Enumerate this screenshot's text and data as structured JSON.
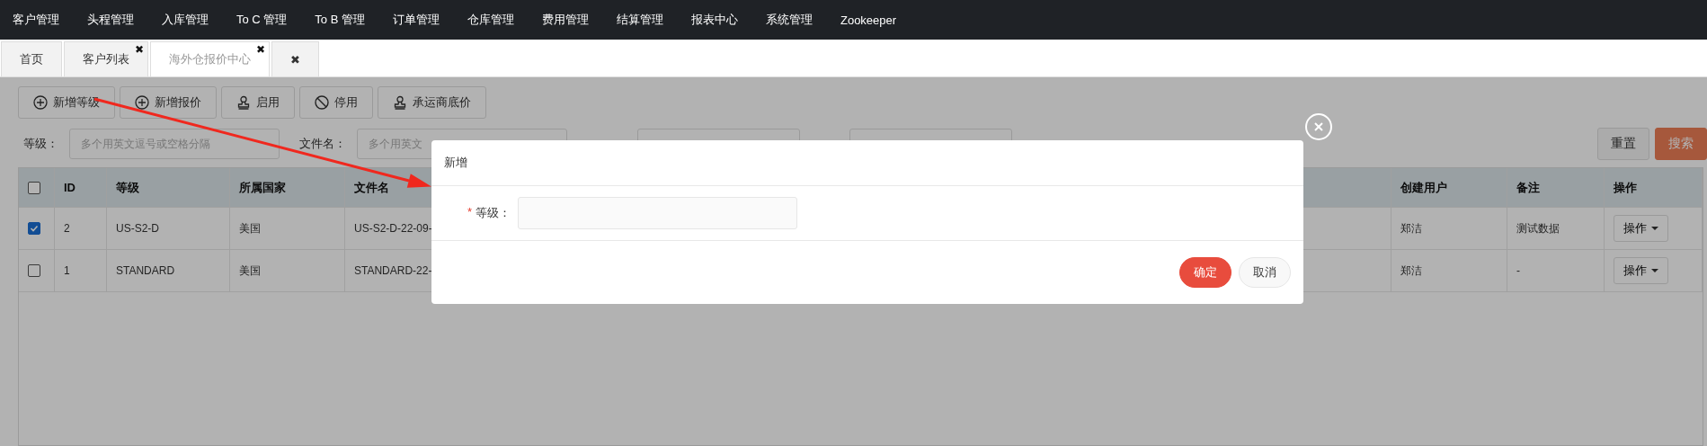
{
  "nav": {
    "items": [
      "客户管理",
      "头程管理",
      "入库管理",
      "To C 管理",
      "To B 管理",
      "订单管理",
      "仓库管理",
      "费用管理",
      "结算管理",
      "报表中心",
      "系统管理",
      "Zookeeper"
    ]
  },
  "tabs": [
    {
      "label": "首页",
      "selected": false
    },
    {
      "label": "客户列表",
      "selected": false,
      "close": "✖"
    },
    {
      "label": "海外仓报价中心",
      "selected": true,
      "close": "✖"
    },
    {
      "label": "✖",
      "selected": false
    }
  ],
  "toolbar": [
    {
      "label": "新增等级",
      "kind": "plus"
    },
    {
      "label": "新增报价",
      "kind": "plus"
    },
    {
      "label": "启用",
      "kind": "stamp"
    },
    {
      "label": "停用",
      "kind": "ban"
    },
    {
      "label": "承运商底价",
      "kind": "stamp"
    }
  ],
  "filters": [
    {
      "label": "等级：",
      "placeholder": "多个用英文逗号或空格分隔"
    },
    {
      "label": "文件名：",
      "placeholder": "多个用英文"
    }
  ],
  "filter_buttons": [
    {
      "label": "重置",
      "kind": "plain"
    },
    {
      "label": "搜索",
      "kind": "primary"
    }
  ],
  "table": {
    "select_all": false,
    "columns": [
      "ID",
      "等级",
      "所属国家",
      "文件名",
      "创建用户",
      "备注",
      "操作"
    ],
    "rows": [
      {
        "selected": true,
        "cells": [
          "2",
          "US-S2-D",
          "美国",
          "US-S2-D-22-09-",
          "郑洁",
          "测试数据"
        ],
        "action": "操作"
      },
      {
        "selected": false,
        "cells": [
          "1",
          "STANDARD",
          "美国",
          "STANDARD-22-",
          "郑洁",
          "-"
        ],
        "action": "操作"
      }
    ]
  },
  "dialog": {
    "title": "新增",
    "field": {
      "required_mark": "*",
      "label": "等级："
    },
    "buttons": [
      {
        "label": "确定",
        "kind": "primary"
      },
      {
        "label": "取消",
        "kind": "plain"
      }
    ]
  }
}
